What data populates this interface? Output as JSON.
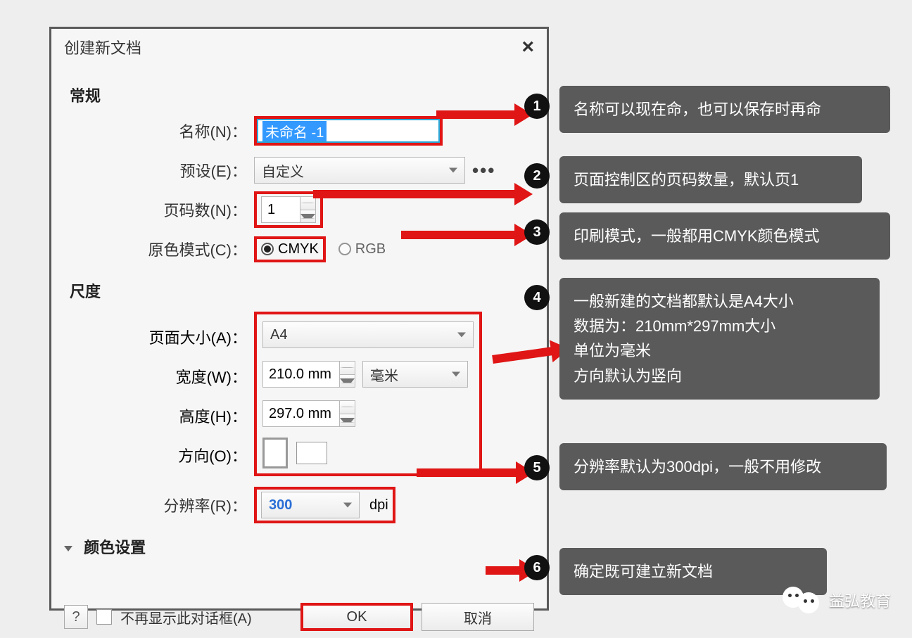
{
  "dialog": {
    "title": "创建新文档",
    "close_x": "×",
    "general_section": "常规",
    "name_label": "名称(N)：",
    "name_value": "未命名 -1",
    "preset_label": "预设(E)：",
    "preset_value": "自定义",
    "preset_more": "•••",
    "pages_label": "页码数(N)：",
    "pages_value": "1",
    "color_mode_label": "原色模式(C)：",
    "color_mode_cmyk": "CMYK",
    "color_mode_rgb": "RGB",
    "dimensions_section": "尺度",
    "page_size_label": "页面大小(A)：",
    "page_size_value": "A4",
    "width_label": "宽度(W)：",
    "width_value": "210.0 mm",
    "unit_value": "毫米",
    "height_label": "高度(H)：",
    "height_value": "297.0 mm",
    "orientation_label": "方向(O)：",
    "resolution_label": "分辨率(R)：",
    "resolution_value": "300",
    "resolution_unit": "dpi",
    "color_settings_section": "颜色设置",
    "help": "?",
    "dont_show_label": "不再显示此对话框(A)",
    "ok_label": "OK",
    "cancel_label": "取消"
  },
  "callouts": {
    "c1": "名称可以现在命，也可以保存时再命",
    "c2": "页面控制区的页码数量，默认页1",
    "c3": "印刷模式，一般都用CMYK颜色模式",
    "c4_l1": "一般新建的文档都默认是A4大小",
    "c4_l2": "数据为：210mm*297mm大小",
    "c4_l3": "单位为毫米",
    "c4_l4": "方向默认为竖向",
    "c5": "分辨率默认为300dpi，一般不用修改",
    "c6": "确定既可建立新文档"
  },
  "badges": {
    "n1": "1",
    "n2": "2",
    "n3": "3",
    "n4": "4",
    "n5": "5",
    "n6": "6"
  },
  "watermark": {
    "text": "益弘教育"
  }
}
